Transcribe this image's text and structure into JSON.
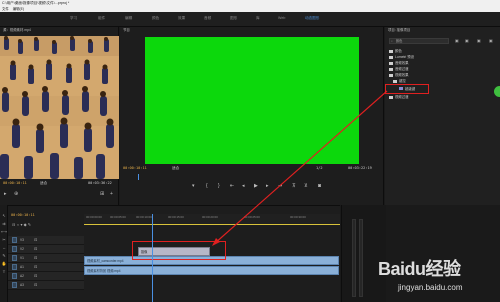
{
  "window": {
    "title": "C:\\用户\\桌面\\抠像项目\\视频\\文件\\...prproj *",
    "menu": [
      "文件",
      "编辑(E)"
    ]
  },
  "workspaces": {
    "items": [
      "学习",
      "组件",
      "编辑",
      "颜色",
      "效果",
      "音频",
      "图形",
      "库",
      "Web",
      "动态图形"
    ],
    "active_index": 9
  },
  "source": {
    "header": "源：视频素材.mp4",
    "timecode_left": "00:00:10:11",
    "fit": "适合",
    "timecode_right": "00:03:36:22"
  },
  "program": {
    "header": "节目",
    "timecode_left": "00:00:10:11",
    "fit": "适合",
    "scale": "1/2",
    "timecode_right": "00:03:22:19",
    "bg_color": "#0cd80c"
  },
  "project": {
    "header": "项目: 抠像项目",
    "search_placeholder": "颜色",
    "items": [
      "颜色",
      "Lumetri 预设",
      "音频效果",
      "音频过渡",
      "视频效果",
      "键控",
      "超级键",
      "视频过渡"
    ],
    "selected_item": "超级键"
  },
  "timeline": {
    "timecode": "00:00:10:11",
    "ruler": [
      "00:00:00:00",
      "00:00:05:00",
      "00:00:10:00",
      "00:00:15:00",
      "00:00:20:00",
      "00:00:25:00",
      "00:00:30:00"
    ],
    "tracks": [
      "V3",
      "V2",
      "V1",
      "A1",
      "A2",
      "A3"
    ],
    "clip_v": "抠像",
    "clip_a1": "视频素材_camcorder.mp4",
    "clip_a2": "视频素材背景 视频.mp4"
  },
  "watermark": {
    "logo": "Baidu经验",
    "url": "jingyan.baidu.com"
  },
  "colors": {
    "accent": "#4a90e2",
    "highlight": "#e02020",
    "timecode": "#e8b04a"
  }
}
